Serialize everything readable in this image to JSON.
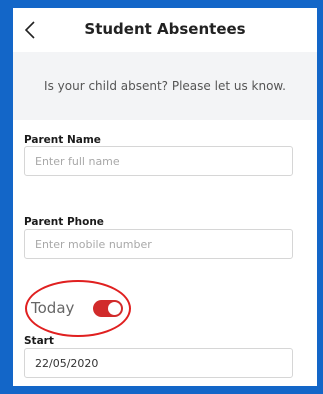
{
  "header": {
    "title": "Student Absentees",
    "back_icon": "chevron-left-icon"
  },
  "banner": {
    "text": "Is your child absent? Please let us know."
  },
  "form": {
    "parent_name": {
      "label": "Parent Name",
      "placeholder": "Enter full name",
      "value": ""
    },
    "parent_phone": {
      "label": "Parent Phone",
      "placeholder": "Enter mobile number",
      "value": ""
    },
    "today": {
      "label": "Today",
      "on": true
    },
    "start": {
      "label": "Start",
      "value": "22/05/2020"
    }
  },
  "colors": {
    "border_frame": "#1366c8",
    "toggle_on": "#d12b2b",
    "highlight": "#e02020"
  }
}
